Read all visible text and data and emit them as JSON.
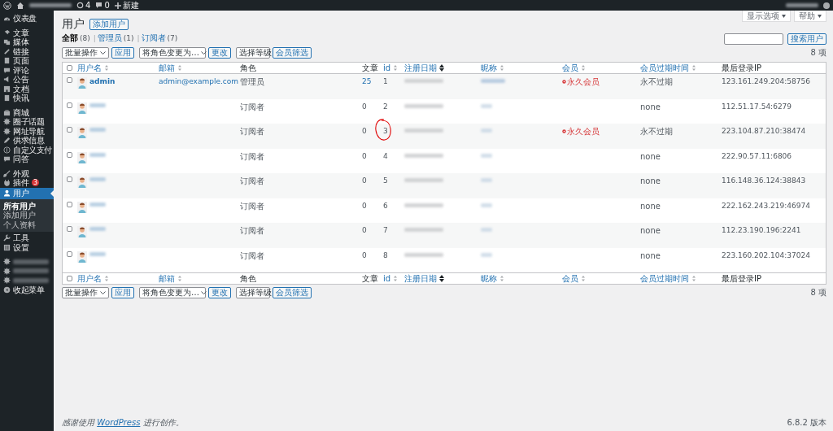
{
  "admin_bar": {
    "updates": "4",
    "comments": "0",
    "new_label": "新建"
  },
  "sidebar": {
    "groups": [
      [
        {
          "label": "仪表盘",
          "selected": false
        }
      ],
      [
        {
          "label": "文章",
          "selected": false
        },
        {
          "label": "媒体",
          "selected": false
        },
        {
          "label": "链接",
          "selected": false
        },
        {
          "label": "页面",
          "selected": false
        },
        {
          "label": "评论",
          "selected": false
        },
        {
          "label": "公告",
          "selected": false
        },
        {
          "label": "文档",
          "selected": false
        },
        {
          "label": "快讯",
          "selected": false
        }
      ],
      [
        {
          "label": "商城",
          "selected": false
        },
        {
          "label": "圈子话题",
          "selected": false
        },
        {
          "label": "网址导航",
          "selected": false
        },
        {
          "label": "供求信息",
          "selected": false
        },
        {
          "label": "自定义支付",
          "selected": false
        },
        {
          "label": "问答",
          "selected": false
        }
      ],
      [
        {
          "label": "外观",
          "selected": false
        },
        {
          "label": "插件",
          "selected": false,
          "badge": "3"
        },
        {
          "label": "用户",
          "selected": true,
          "children": [
            {
              "label": "所有用户",
              "selected": true
            },
            {
              "label": "添加用户",
              "selected": false
            },
            {
              "label": "个人资料",
              "selected": false
            }
          ]
        },
        {
          "label": "工具",
          "selected": false
        },
        {
          "label": "设置",
          "selected": false
        }
      ],
      [
        {
          "selected": false
        },
        {
          "selected": false
        },
        {
          "selected": false
        },
        {
          "label": "收起菜单",
          "selected": false
        }
      ]
    ]
  },
  "screen_meta": [
    "显示选项",
    "帮助"
  ],
  "page": {
    "title": "用户",
    "add_button": "添加用户"
  },
  "views": [
    {
      "label": "全部",
      "count": "(8)",
      "selected": true
    },
    {
      "separator": "|",
      "label": "管理员",
      "count": "(1)",
      "selected": false
    },
    {
      "separator": "|",
      "label": "订阅者",
      "count": "(7)",
      "selected": false
    }
  ],
  "search": {
    "button": "搜索用户"
  },
  "tablenav_top": {
    "bulk": "批量操作",
    "apply": "应用",
    "role": "将角色变更为…",
    "change": "更改",
    "level": "选择等级",
    "filter": "会员筛选",
    "count": "8 项"
  },
  "table": {
    "header_checked": false,
    "columns": [
      {
        "label": "用户名",
        "sortable": true,
        "sorted": false
      },
      {
        "label": "邮箱",
        "sortable": true,
        "sorted": false
      },
      {
        "label": "角色",
        "sortable": false
      },
      {
        "label": "文章",
        "sortable": false
      },
      {
        "label": "id",
        "sortable": true,
        "sorted": false
      },
      {
        "label": "注册日期",
        "sortable": true,
        "sorted": true
      },
      {
        "label": "昵称",
        "sortable": true,
        "sorted": false
      },
      {
        "label": "会员",
        "sortable": true,
        "sorted": false
      },
      {
        "label": "会员过期时间",
        "sortable": true,
        "sorted": false
      },
      {
        "label": "最后登录IP",
        "sortable": false
      }
    ],
    "rows": [
      {
        "checked": false,
        "username": "admin",
        "email": "admin@example.com",
        "role": "管理员",
        "posts": "25",
        "id": "1",
        "membership": "永久会员",
        "expiry": "永不过期",
        "ip": "123.161.249.204:58756",
        "circled": false
      },
      {
        "checked": false,
        "role": "订阅者",
        "posts": "0",
        "id": "2",
        "expiry": "none",
        "ip": "112.51.17.54:6279",
        "circled": false
      },
      {
        "checked": false,
        "role": "订阅者",
        "posts": "0",
        "id": "3",
        "membership": "永久会员",
        "expiry": "永不过期",
        "ip": "223.104.87.210:38474",
        "circled": true
      },
      {
        "checked": false,
        "role": "订阅者",
        "posts": "0",
        "id": "4",
        "expiry": "none",
        "ip": "222.90.57.11:6806",
        "circled": false
      },
      {
        "checked": false,
        "role": "订阅者",
        "posts": "0",
        "id": "5",
        "expiry": "none",
        "ip": "116.148.36.124:38843",
        "circled": false
      },
      {
        "checked": false,
        "role": "订阅者",
        "posts": "0",
        "id": "6",
        "expiry": "none",
        "ip": "222.162.243.219:46974",
        "circled": false
      },
      {
        "checked": false,
        "role": "订阅者",
        "posts": "0",
        "id": "7",
        "expiry": "none",
        "ip": "112.23.190.196:2241",
        "circled": false
      },
      {
        "checked": false,
        "role": "订阅者",
        "posts": "0",
        "id": "8",
        "expiry": "none",
        "ip": "223.160.202.104:37024",
        "circled": false
      }
    ],
    "footer_checked": false,
    "footer_columns": [
      {
        "label": "用户名",
        "sortable": true,
        "sorted": false
      },
      {
        "label": "邮箱",
        "sortable": true,
        "sorted": false
      },
      {
        "label": "角色",
        "sortable": false
      },
      {
        "label": "文章",
        "sortable": false
      },
      {
        "label": "id",
        "sortable": true,
        "sorted": false
      },
      {
        "label": "注册日期",
        "sortable": true,
        "sorted": true
      },
      {
        "label": "昵称",
        "sortable": true,
        "sorted": false
      },
      {
        "label": "会员",
        "sortable": true,
        "sorted": false
      },
      {
        "label": "会员过期时间",
        "sortable": true,
        "sorted": false
      },
      {
        "label": "最后登录IP",
        "sortable": false
      }
    ]
  },
  "tablenav_bottom": {
    "bulk": "批量操作",
    "apply": "应用",
    "role": "将角色变更为…",
    "change": "更改",
    "level": "选择等级",
    "filter": "会员筛选",
    "count": "8 项"
  },
  "footer": {
    "thanks_before": "感谢使用",
    "thanks_link": "WordPress",
    "thanks_after": "进行创作。",
    "version": "6.8.2 版本"
  }
}
